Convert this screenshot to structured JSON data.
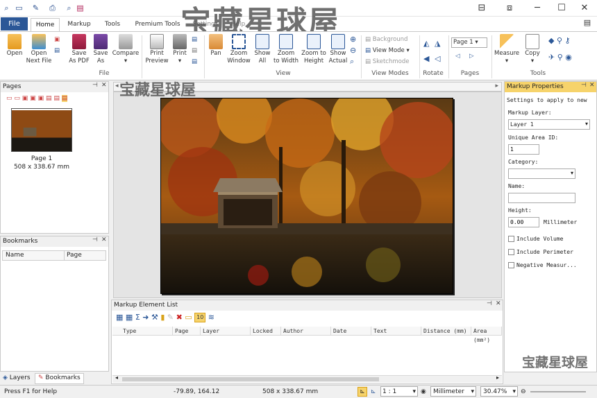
{
  "watermark": {
    "text": "宝藏星球屋"
  },
  "tabs": {
    "file": "File",
    "home": "Home",
    "markup": "Markup",
    "tools": "Tools",
    "premium": "Premium Tools",
    "settings": "Settings",
    "help": "Help"
  },
  "ribbon": {
    "open": "Open",
    "open_next": "Open",
    "open_next2": "Next File",
    "save_pdf": "Save",
    "save_pdf2": "As PDF",
    "save_as": "Save",
    "save_as2": "As",
    "compare": "Compare",
    "print_preview": "Print",
    "print_preview2": "Preview",
    "print": "Print",
    "file_group": "File",
    "pan": "Pan",
    "zoom_window": "Zoom",
    "zoom_window2": "Window",
    "show_all": "Show",
    "show_all2": "All",
    "zoom_width": "Zoom",
    "zoom_width2": "to Width",
    "zoom_height": "Zoom to",
    "zoom_height2": "Height",
    "show_actual": "Show",
    "show_actual2": "Actual",
    "view_group": "View",
    "background": "Background",
    "view_mode": "View Mode",
    "sketchmode": "Sketchmode",
    "view_modes_group": "View Modes",
    "rotate_group": "Rotate",
    "page_select": "Page 1",
    "pages_group": "Pages",
    "measure": "Measure",
    "copy": "Copy",
    "tools_group": "Tools"
  },
  "pages_panel": {
    "title": "Pages",
    "page_label": "Page 1",
    "page_size": "508 x 338.67 mm"
  },
  "bookmarks_panel": {
    "title": "Bookmarks",
    "col_name": "Name",
    "col_page": "Page"
  },
  "bottom_tabs": {
    "layers": "Layers",
    "bookmarks": "Bookmarks"
  },
  "markup_list": {
    "title": "Markup Element List",
    "count_badge": "10",
    "columns": [
      "Type",
      "Page",
      "Layer",
      "Locked",
      "Author",
      "Date",
      "Text",
      "Distance (mm)",
      "Area (mm²)"
    ]
  },
  "markup_props": {
    "title": "Markup Properties",
    "intro": "Settings to apply to new",
    "layer_label": "Markup Layer:",
    "layer_value": "Layer 1",
    "area_id_label": "Unique Area ID:",
    "area_id_value": "1",
    "category_label": "Category:",
    "name_label": "Name:",
    "height_label": "Height:",
    "height_value": "0.00",
    "height_unit": "Millimeter",
    "include_volume": "Include Volume",
    "include_perimeter": "Include Perimeter",
    "negative_measure": "Negative Measur..."
  },
  "status": {
    "help": "Press F1 for Help",
    "coords": "-79.89, 164.12",
    "doc_size": "508 x 338.67 mm",
    "scale": "1 : 1",
    "unit": "Millimeter",
    "zoom": "30.47%"
  },
  "colors": {
    "accent": "#2b5797",
    "highlight": "#f6d36b"
  }
}
